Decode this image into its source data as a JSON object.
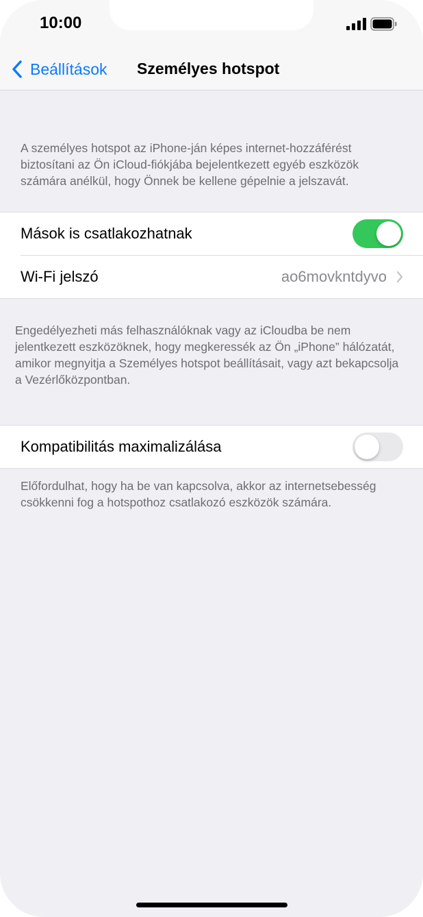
{
  "status": {
    "time": "10:00"
  },
  "nav": {
    "back_label": "Beállítások",
    "title": "Személyes hotspot"
  },
  "intro_text": "A személyes hotspot az iPhone-ján képes internet-hozzáférést biztosítani az Ön iCloud-fiókjába bejelentkezett egyéb eszközök számára anélkül, hogy Önnek be kellene gépelnie a jelszavát.",
  "hotspot_group": {
    "allow_others": {
      "label": "Mások is csatlakozhatnak",
      "enabled": true
    },
    "wifi_password": {
      "label": "Wi-Fi jelszó",
      "value": "ao6movkntdyvo"
    }
  },
  "allow_others_footer": "Engedélyezheti más felhasználóknak vagy az iCloudba be nem jelentkezett eszközöknek, hogy megkeressék az Ön „iPhone” hálózatát, amikor megnyitja a Személyes hotspot beállításait, vagy azt bekapcsolja a Vezérlőközpontban.",
  "compat_group": {
    "label": "Kompatibilitás maximalizálása",
    "enabled": false
  },
  "compat_footer": "Előfordulhat, hogy ha be van kapcsolva, akkor az internetsebesség csökkenni fog a hotspothoz csatlakozó eszközök számára.",
  "colors": {
    "accent": "#0a7aff",
    "toggle_on": "#34c759",
    "background": "#efeff4"
  },
  "icons": [
    "signal-icon",
    "battery-icon",
    "chevron-left-icon",
    "chevron-right-icon"
  ]
}
